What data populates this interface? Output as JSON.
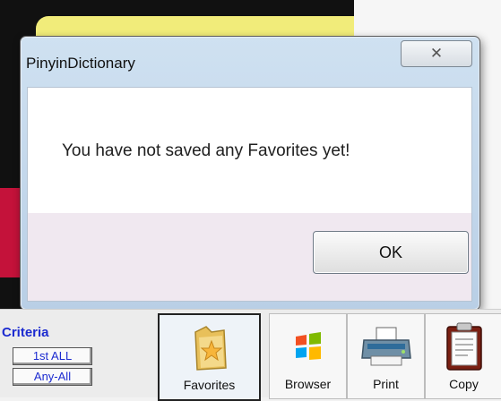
{
  "dialog": {
    "title": "PinyinDictionary",
    "close_glyph": "✕",
    "message": "You have not saved any Favorites yet!",
    "ok_label": "OK"
  },
  "toolbar": {
    "criteria_label": "Criteria",
    "first_all_label": "1st ALL",
    "any_all_label": "Any-All",
    "buttons": [
      {
        "label": "Favorites",
        "icon": "folder-star-icon"
      },
      {
        "label": "Browser",
        "icon": "windows-logo-icon"
      },
      {
        "label": "Print",
        "icon": "printer-icon"
      },
      {
        "label": "Copy",
        "icon": "clipboard-icon"
      }
    ]
  },
  "colors": {
    "criteria_blue": "#1c2bd0",
    "dialog_frame": "#c4d7ea",
    "footer_tint": "#f0e8f0"
  }
}
